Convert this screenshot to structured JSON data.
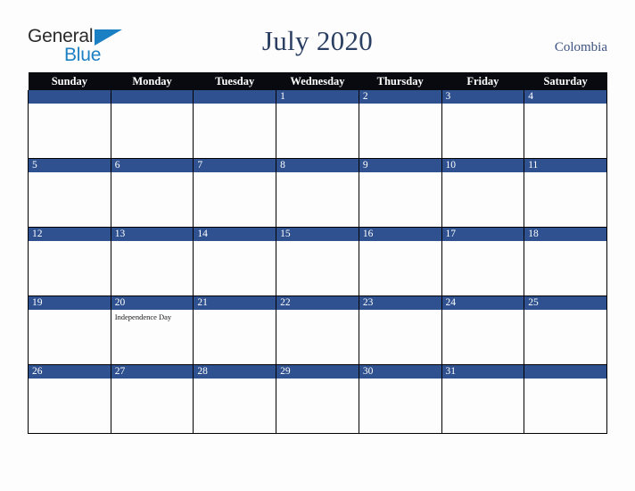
{
  "brand": {
    "name_top": "General",
    "name_bottom": "Blue",
    "triangle_icon": "blue-triangle-icon",
    "top_color": "#2b2b2b",
    "bottom_color": "#1b7fc4"
  },
  "header": {
    "title": "July 2020",
    "title_color": "#2b3f63",
    "country": "Colombia",
    "country_color": "#3c5280"
  },
  "theme": {
    "page_background": "#fdfdfd",
    "weekday_header_background": "#090a10",
    "weekday_header_text": "#ffffff",
    "date_band_background": "#2f5190",
    "date_band_text": "#ffffff",
    "cell_background": "#fdfdfd",
    "grid_line": "#000000"
  },
  "calendar": {
    "month": "July",
    "year": "2020",
    "weekday_headers": [
      "Sunday",
      "Monday",
      "Tuesday",
      "Wednesday",
      "Thursday",
      "Friday",
      "Saturday"
    ],
    "weeks": [
      [
        {
          "date": "",
          "event": ""
        },
        {
          "date": "",
          "event": ""
        },
        {
          "date": "",
          "event": ""
        },
        {
          "date": "1",
          "event": ""
        },
        {
          "date": "2",
          "event": ""
        },
        {
          "date": "3",
          "event": ""
        },
        {
          "date": "4",
          "event": ""
        }
      ],
      [
        {
          "date": "5",
          "event": ""
        },
        {
          "date": "6",
          "event": ""
        },
        {
          "date": "7",
          "event": ""
        },
        {
          "date": "8",
          "event": ""
        },
        {
          "date": "9",
          "event": ""
        },
        {
          "date": "10",
          "event": ""
        },
        {
          "date": "11",
          "event": ""
        }
      ],
      [
        {
          "date": "12",
          "event": ""
        },
        {
          "date": "13",
          "event": ""
        },
        {
          "date": "14",
          "event": ""
        },
        {
          "date": "15",
          "event": ""
        },
        {
          "date": "16",
          "event": ""
        },
        {
          "date": "17",
          "event": ""
        },
        {
          "date": "18",
          "event": ""
        }
      ],
      [
        {
          "date": "19",
          "event": ""
        },
        {
          "date": "20",
          "event": "Independence Day"
        },
        {
          "date": "21",
          "event": ""
        },
        {
          "date": "22",
          "event": ""
        },
        {
          "date": "23",
          "event": ""
        },
        {
          "date": "24",
          "event": ""
        },
        {
          "date": "25",
          "event": ""
        }
      ],
      [
        {
          "date": "26",
          "event": ""
        },
        {
          "date": "27",
          "event": ""
        },
        {
          "date": "28",
          "event": ""
        },
        {
          "date": "29",
          "event": ""
        },
        {
          "date": "30",
          "event": ""
        },
        {
          "date": "31",
          "event": ""
        },
        {
          "date": "",
          "event": ""
        }
      ]
    ]
  }
}
